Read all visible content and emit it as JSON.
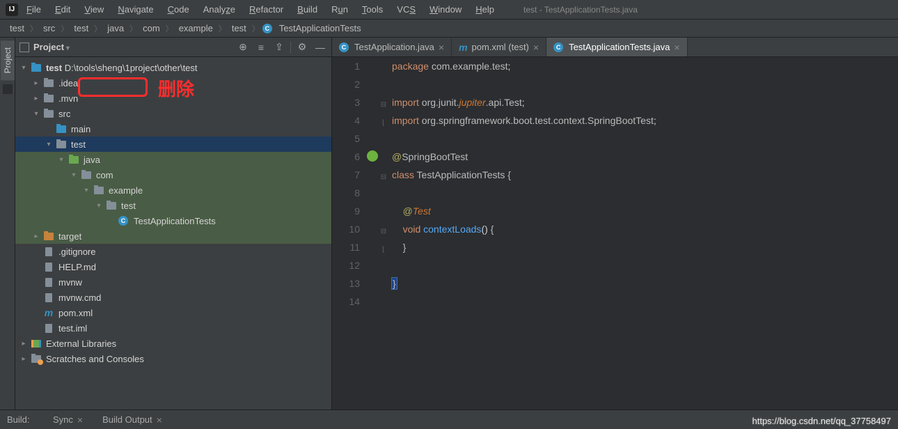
{
  "window_title": "test - TestApplicationTests.java",
  "menus": [
    "File",
    "Edit",
    "View",
    "Navigate",
    "Code",
    "Analyze",
    "Refactor",
    "Build",
    "Run",
    "Tools",
    "VCS",
    "Window",
    "Help"
  ],
  "breadcrumbs": [
    "test",
    "src",
    "test",
    "java",
    "com",
    "example",
    "test",
    "TestApplicationTests"
  ],
  "project_panel": {
    "title": "Project"
  },
  "vertical_tab": "Project",
  "tree": {
    "root": {
      "name": "test",
      "path": "D:\\tools\\sheng\\1project\\other\\test"
    },
    "items": [
      {
        "indent": 1,
        "toggle": "closed",
        "icon": "folder",
        "label": ".idea"
      },
      {
        "indent": 1,
        "toggle": "closed",
        "icon": "folder",
        "label": ".mvn"
      },
      {
        "indent": 1,
        "toggle": "open",
        "icon": "folder",
        "label": "src"
      },
      {
        "indent": 2,
        "toggle": "none",
        "icon": "folder-blue",
        "label": "main"
      },
      {
        "indent": 2,
        "toggle": "open",
        "icon": "folder",
        "label": "test",
        "selected": true,
        "green": true
      },
      {
        "indent": 3,
        "toggle": "open",
        "icon": "folder-green",
        "label": "java",
        "green": true
      },
      {
        "indent": 4,
        "toggle": "open",
        "icon": "folder",
        "label": "com",
        "green": true
      },
      {
        "indent": 5,
        "toggle": "open",
        "icon": "folder",
        "label": "example",
        "green": true
      },
      {
        "indent": 6,
        "toggle": "open",
        "icon": "folder",
        "label": "test",
        "green": true
      },
      {
        "indent": 7,
        "toggle": "none",
        "icon": "class",
        "label": "TestApplicationTests",
        "green": true
      },
      {
        "indent": 1,
        "toggle": "closed",
        "icon": "folder-orange",
        "label": "target",
        "green": true
      },
      {
        "indent": 1,
        "toggle": "none",
        "icon": "file",
        "label": ".gitignore"
      },
      {
        "indent": 1,
        "toggle": "none",
        "icon": "file",
        "label": "HELP.md"
      },
      {
        "indent": 1,
        "toggle": "none",
        "icon": "file",
        "label": "mvnw"
      },
      {
        "indent": 1,
        "toggle": "none",
        "icon": "file",
        "label": "mvnw.cmd"
      },
      {
        "indent": 1,
        "toggle": "none",
        "icon": "m",
        "label": "pom.xml"
      },
      {
        "indent": 1,
        "toggle": "none",
        "icon": "file",
        "label": "test.iml"
      }
    ],
    "external_libs": "External Libraries",
    "scratches": "Scratches and Consoles"
  },
  "annotation_text": "删除",
  "tabs": [
    {
      "icon": "class",
      "label": "TestApplication.java",
      "active": false
    },
    {
      "icon": "m",
      "label": "pom.xml (test)",
      "active": false
    },
    {
      "icon": "class",
      "label": "TestApplicationTests.java",
      "active": true
    }
  ],
  "code_lines": [
    "package com.example.test;",
    "",
    "import org.junit.jupiter.api.Test;",
    "import org.springframework.boot.test.context.SpringBootTest;",
    "",
    "@SpringBootTest",
    "class TestApplicationTests {",
    "",
    "    @Test",
    "    void contextLoads() {",
    "    }",
    "",
    "}",
    ""
  ],
  "bottom": {
    "build": "Build:",
    "sync": "Sync",
    "output": "Build Output"
  },
  "watermark": "https://blog.csdn.net/qq_37758497"
}
